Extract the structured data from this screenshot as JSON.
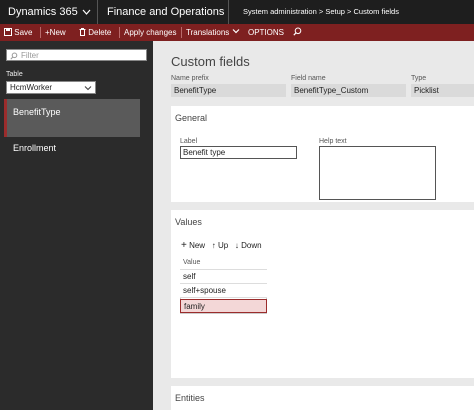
{
  "nav": {
    "app_name": "Dynamics 365",
    "module": "Finance and Operations",
    "breadcrumb": [
      "System administration",
      "Setup",
      "Custom fields"
    ]
  },
  "actions": {
    "save": "Save",
    "new": "New",
    "delete": "Delete",
    "apply_changes": "Apply changes",
    "translations": "Translations",
    "options": "OPTIONS"
  },
  "left": {
    "filter_placeholder": "Filter",
    "table_label": "Table",
    "table_value": "HcmWorker",
    "items": [
      {
        "label": "BenefitType",
        "selected": true
      },
      {
        "label": "Enrollment",
        "selected": false
      }
    ]
  },
  "main": {
    "title": "Custom fields",
    "name_prefix_label": "Name prefix",
    "name_prefix_value": "BenefitType",
    "field_name_label": "Field name",
    "field_name_value": "BenefitType_Custom",
    "type_label": "Type",
    "type_value": "Picklist",
    "general": {
      "title": "General",
      "label_label": "Label",
      "label_value": "Benefit type",
      "help_label": "Help text"
    },
    "values": {
      "title": "Values",
      "new": "New",
      "up": "Up",
      "down": "Down",
      "column": "Value",
      "rows": [
        "self",
        "self+spouse",
        "family"
      ]
    },
    "entities_title": "Entities"
  },
  "colors": {
    "nav_bg": "#1e1e1e",
    "action_bar": "#7e2020",
    "left_pane": "#2b2b2b",
    "selected_row": "#f3d7d7"
  }
}
